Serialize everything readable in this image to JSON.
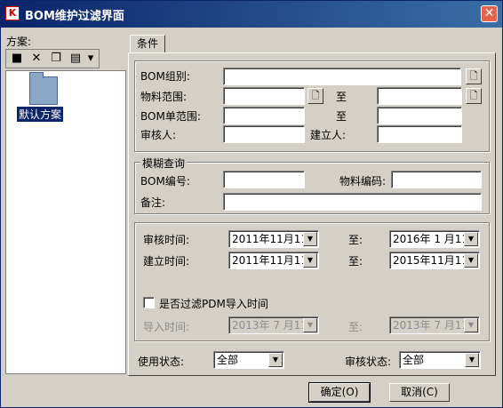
{
  "window": {
    "title": "BOM维护过滤界面",
    "app_icon": "K",
    "close_glyph": "✕"
  },
  "left": {
    "label": "方案:",
    "toolbar": [
      {
        "icon": "save-icon",
        "glyph": "■"
      },
      {
        "icon": "delete-icon",
        "glyph": "✕"
      },
      {
        "icon": "copy-icon",
        "glyph": "❐"
      },
      {
        "icon": "properties-icon",
        "glyph": "▤"
      },
      {
        "icon": "dropdown-icon",
        "glyph": "▾"
      }
    ],
    "tree_item": "默认方案"
  },
  "tab": {
    "label": "条件"
  },
  "conditions": {
    "bom_group_label": "BOM组别:",
    "material_range_label": "物料范围:",
    "bom_list_range_label": "BOM单范围:",
    "auditor_label": "审核人:",
    "to_label_1": "至",
    "to_label_2": "至",
    "creator_label": "建立人:",
    "browse_glyph": "🗋"
  },
  "fuzzy": {
    "legend": "模糊查询",
    "bom_no_label": "BOM编号:",
    "material_code_label": "物料编码:",
    "remark_label": "备注:"
  },
  "time": {
    "audit_time_label": "审核时间:",
    "audit_from": "2011年11月11日",
    "audit_to_label": "至:",
    "audit_to": "2016年 1 月11日",
    "create_time_label": "建立时间:",
    "create_from": "2011年11月11日",
    "create_to_label": "至:",
    "create_to": "2015年11月11日",
    "pdm_checkbox_label": "是否过滤PDM导入时间",
    "import_time_label": "导入时间:",
    "import_from": "2013年 7 月11日",
    "import_to_label": "至:",
    "import_to": "2013年 7 月11日"
  },
  "status": {
    "use_status_label": "使用状态:",
    "use_status_value": "全部",
    "audit_status_label": "审核状态:",
    "audit_status_value": "全部"
  },
  "buttons": {
    "ok": "确定(O)",
    "cancel": "取消(C)"
  }
}
